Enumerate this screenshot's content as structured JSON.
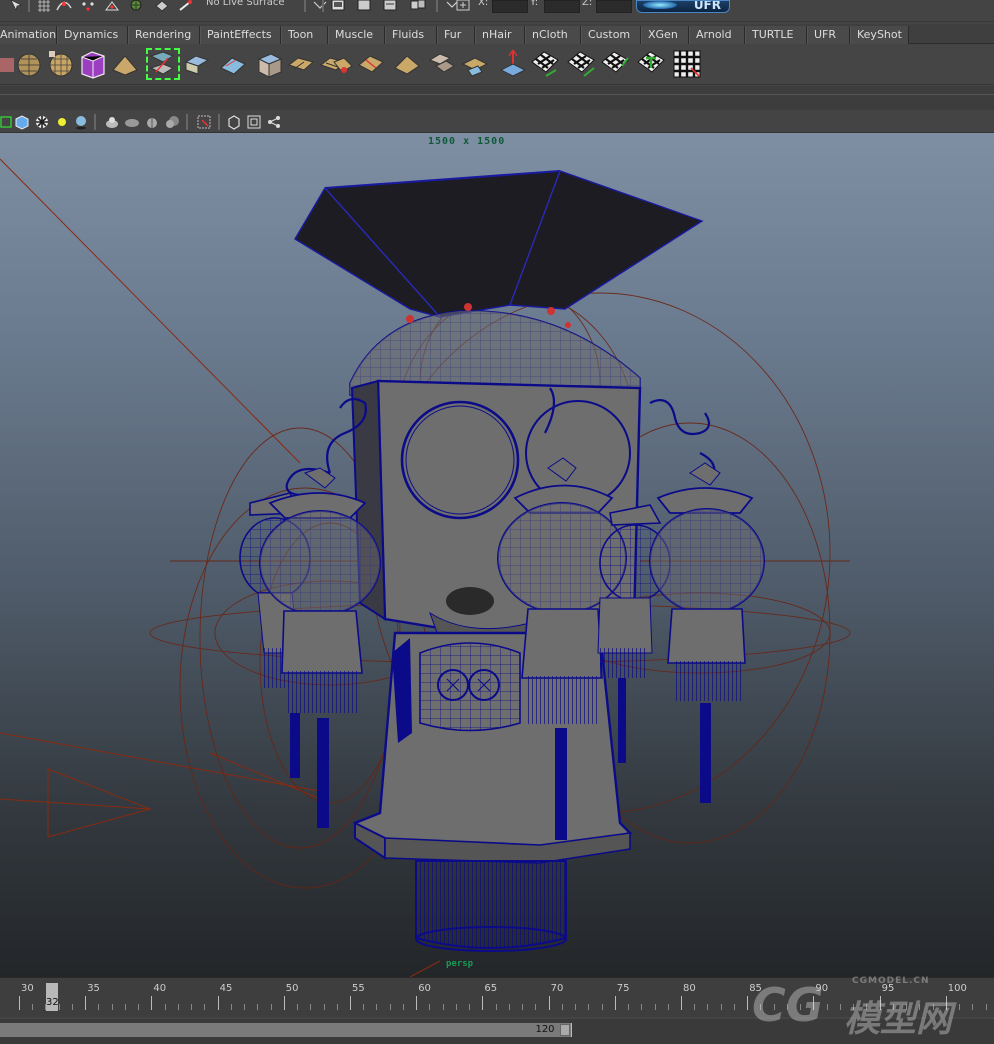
{
  "status_line": {
    "live_surface": "No Live Surface",
    "coords": [
      {
        "label": "X:"
      },
      {
        "label": "Y:"
      },
      {
        "label": "Z:"
      }
    ],
    "ufr_button": "UFR"
  },
  "shelf_tabs": [
    {
      "label": "Animation"
    },
    {
      "label": "Dynamics"
    },
    {
      "label": "Rendering"
    },
    {
      "label": "PaintEffects"
    },
    {
      "label": "Toon"
    },
    {
      "label": "Muscle"
    },
    {
      "label": "Fluids"
    },
    {
      "label": "Fur"
    },
    {
      "label": "nHair"
    },
    {
      "label": "nCloth"
    },
    {
      "label": "Custom"
    },
    {
      "label": "XGen"
    },
    {
      "label": "Arnold"
    },
    {
      "label": "TURTLE"
    },
    {
      "label": "UFR"
    },
    {
      "label": "KeyShot"
    }
  ],
  "shelf_icons": [
    "sphere-wire-icon",
    "sphere-checker-icon",
    "purple-cube-icon",
    "plane-icon",
    "selected-uv-tool-icon",
    "cube-unfold-icon",
    "plane-blue-icon",
    "box-icon",
    "cube-flat-icon",
    "cube-flat-icon",
    "cube-flat-red-icon",
    "cube-flat-icon",
    "cube-move-icon",
    "cube-flat-blue-icon",
    "uv-pyramid-icon",
    "checker-arrow-icon",
    "checker-arrow-icon",
    "checker-arrow-icon",
    "checker-t-icon",
    "checker-grid-icon"
  ],
  "panel_toolbar_icons": [
    "wireframe-icon",
    "smooth-shade-icon",
    "textured-icon",
    "lights-icon",
    "shadows-icon",
    "xray-icon",
    "xray-joints-icon",
    "xray-components-icon",
    "isolate-select-icon",
    "grid-icon",
    "film-gate-icon",
    "resolution-gate-icon"
  ],
  "viewport": {
    "resolution_label": "1500 x 1500",
    "camera_label": "persp"
  },
  "time_slider": {
    "ticks": [
      "30",
      "35",
      "40",
      "45",
      "50",
      "55",
      "60",
      "65",
      "70",
      "75",
      "80",
      "85",
      "90",
      "95",
      "100"
    ],
    "current_frame": "32"
  },
  "range_slider": {
    "end_value": "120"
  },
  "watermark": {
    "url": "CGMODEL.CN",
    "cg": "CG",
    "cn": "模型网"
  },
  "colors": {
    "wire": "#0a0a8a",
    "surface": "#6e6e6e",
    "selection": "#8a2a10"
  }
}
